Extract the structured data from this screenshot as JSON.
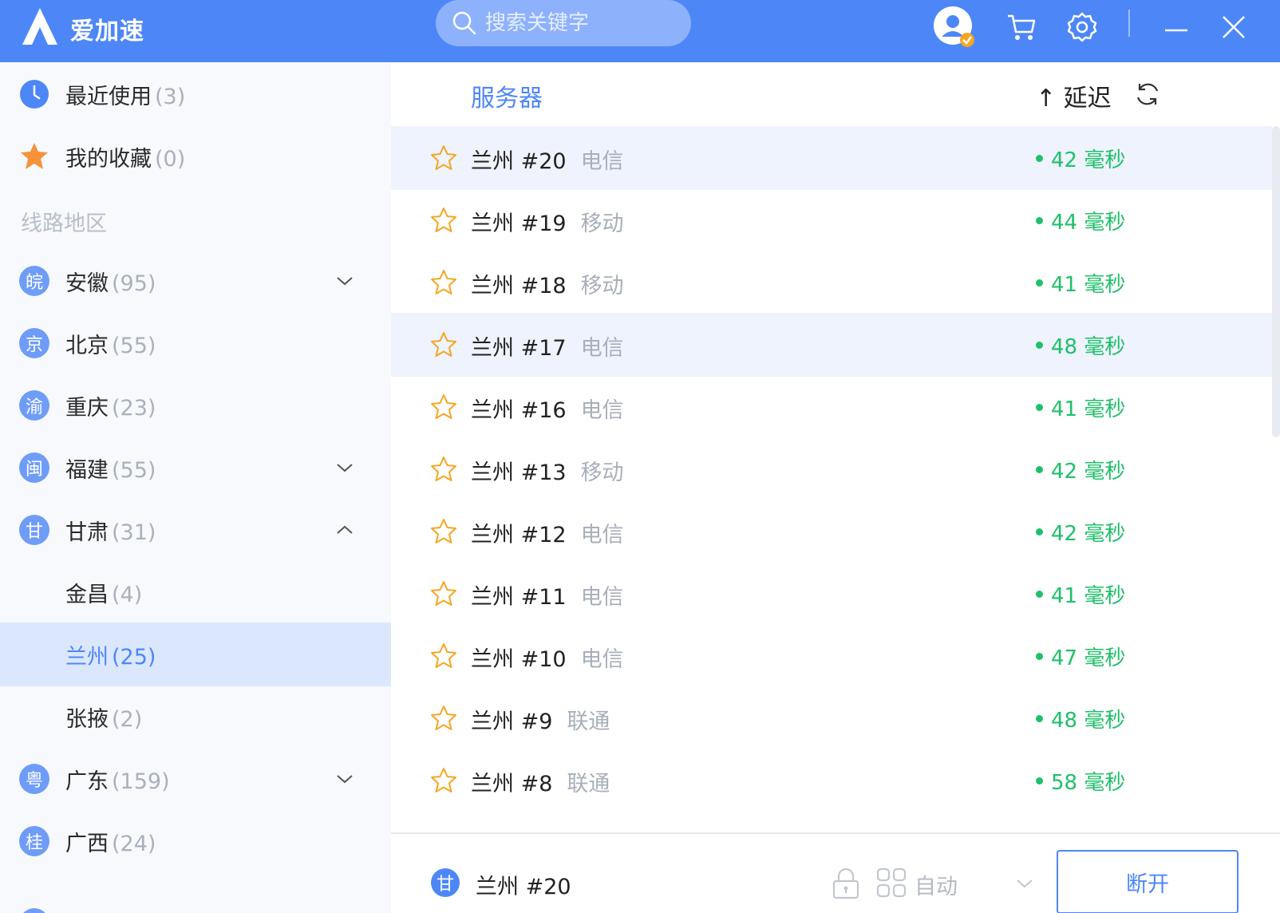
{
  "app": {
    "name": "爱加速",
    "logo_letter": "A"
  },
  "search": {
    "placeholder": "搜索关键字"
  },
  "titlebar_icons": [
    "user-avatar-icon",
    "cart-icon",
    "gear-icon",
    "minimize-icon",
    "close-icon"
  ],
  "sidebar": {
    "recent": {
      "label": "最近使用",
      "count": "(3)"
    },
    "favorites": {
      "label": "我的收藏",
      "count": "(0)"
    },
    "section_title": "线路地区",
    "regions": [
      {
        "abbr": "皖",
        "label": "安徽",
        "count": "(95)",
        "expand": "collapsed"
      },
      {
        "abbr": "京",
        "label": "北京",
        "count": "(55)",
        "expand": "none"
      },
      {
        "abbr": "渝",
        "label": "重庆",
        "count": "(23)",
        "expand": "none"
      },
      {
        "abbr": "闽",
        "label": "福建",
        "count": "(55)",
        "expand": "collapsed"
      },
      {
        "abbr": "甘",
        "label": "甘肃",
        "count": "(31)",
        "expand": "expanded"
      },
      {
        "abbr": "",
        "label": "金昌",
        "count": "(4)",
        "expand": "child"
      },
      {
        "abbr": "",
        "label": "兰州",
        "count": "(25)",
        "expand": "child-active"
      },
      {
        "abbr": "",
        "label": "张掖",
        "count": "(2)",
        "expand": "child"
      },
      {
        "abbr": "粤",
        "label": "广东",
        "count": "(159)",
        "expand": "collapsed"
      },
      {
        "abbr": "桂",
        "label": "广西",
        "count": "(24)",
        "expand": "none"
      }
    ]
  },
  "list": {
    "header_server": "服务器",
    "header_sort": "↑ 延迟",
    "rows": [
      {
        "name": "兰州 #20",
        "isp": "电信",
        "latency": "42 毫秒",
        "highlight": true
      },
      {
        "name": "兰州 #19",
        "isp": "移动",
        "latency": "44 毫秒",
        "highlight": false
      },
      {
        "name": "兰州 #18",
        "isp": "移动",
        "latency": "41 毫秒",
        "highlight": false
      },
      {
        "name": "兰州 #17",
        "isp": "电信",
        "latency": "48 毫秒",
        "highlight": true
      },
      {
        "name": "兰州 #16",
        "isp": "电信",
        "latency": "41 毫秒",
        "highlight": false
      },
      {
        "name": "兰州 #13",
        "isp": "移动",
        "latency": "42 毫秒",
        "highlight": false
      },
      {
        "name": "兰州 #12",
        "isp": "电信",
        "latency": "42 毫秒",
        "highlight": false
      },
      {
        "name": "兰州 #11",
        "isp": "电信",
        "latency": "41 毫秒",
        "highlight": false
      },
      {
        "name": "兰州 #10",
        "isp": "电信",
        "latency": "47 毫秒",
        "highlight": false
      },
      {
        "name": "兰州 #9",
        "isp": "联通",
        "latency": "48 毫秒",
        "highlight": false
      },
      {
        "name": "兰州 #8",
        "isp": "联通",
        "latency": "58 毫秒",
        "highlight": false
      }
    ]
  },
  "footer": {
    "current_abbr": "甘",
    "current_server": "兰州 #20",
    "mode_label": "自动",
    "disconnect_label": "断开"
  },
  "colors": {
    "brand": "#4d87f7",
    "latency_good": "#1fc06a",
    "favorite_star": "#f5a623"
  }
}
